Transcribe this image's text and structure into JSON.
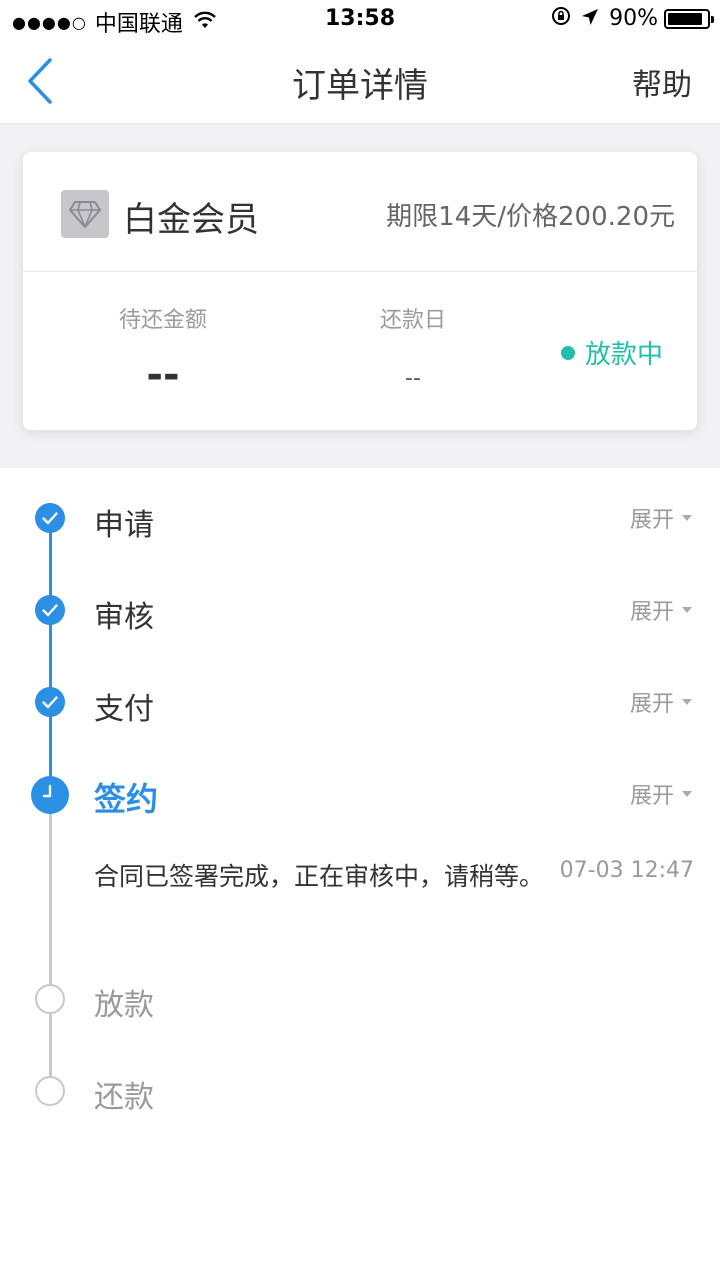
{
  "status_bar": {
    "signal": "●●●●○",
    "carrier": "中国联通",
    "wifi_icon": "wifi-icon",
    "time": "13:58",
    "battery_text": "90%",
    "battery_level": 0.9
  },
  "nav": {
    "title": "订单详情",
    "help": "帮助"
  },
  "membership": {
    "name": "白金会员",
    "term": "期限14天/价格200.20元",
    "pending_label": "待还金额",
    "pending_value": "--",
    "due_label": "还款日",
    "due_value": "--",
    "status": "放款中",
    "status_color": "#21bfa9"
  },
  "timeline": {
    "accent_color": "#2b8fe3",
    "steps": [
      {
        "label": "申请",
        "state": "done",
        "expand": "展开"
      },
      {
        "label": "审核",
        "state": "done",
        "expand": "展开"
      },
      {
        "label": "支付",
        "state": "done",
        "expand": "展开"
      },
      {
        "label": "签约",
        "state": "current",
        "expand": "展开",
        "description": "合同已签署完成，正在审核中，请稍等。",
        "time": "07-03 12:47"
      },
      {
        "label": "放款",
        "state": "pending"
      },
      {
        "label": "还款",
        "state": "pending"
      }
    ]
  }
}
